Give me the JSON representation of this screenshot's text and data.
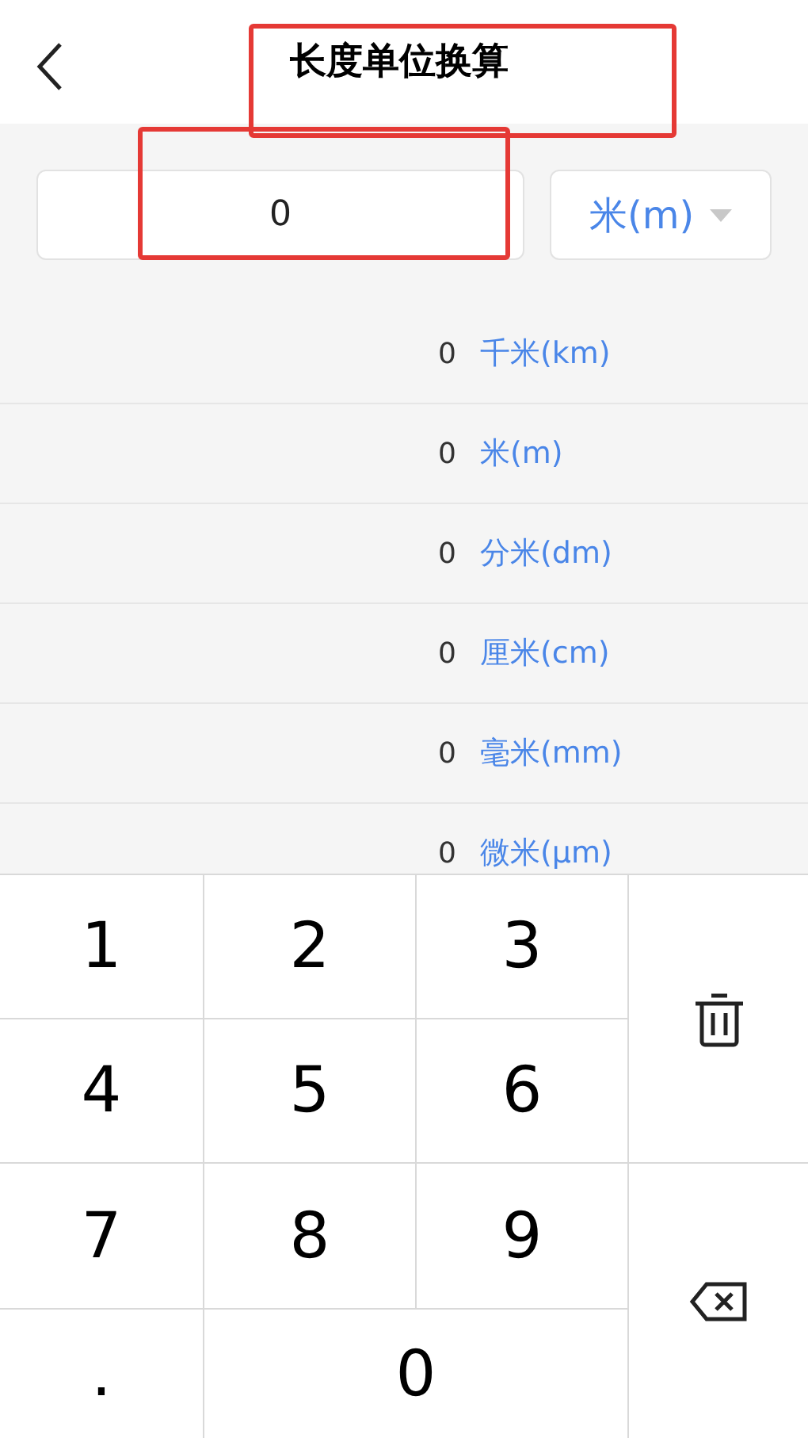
{
  "header": {
    "title": "长度单位换算"
  },
  "input": {
    "value": "0",
    "unit": "米(m)"
  },
  "results": [
    {
      "value": "0",
      "unit": "千米(km)"
    },
    {
      "value": "0",
      "unit": "米(m)"
    },
    {
      "value": "0",
      "unit": "分米(dm)"
    },
    {
      "value": "0",
      "unit": "厘米(cm)"
    },
    {
      "value": "0",
      "unit": "毫米(mm)"
    },
    {
      "value": "0",
      "unit": "微米(μm)"
    }
  ],
  "keypad": [
    {
      "kind": "digit",
      "label": "1"
    },
    {
      "kind": "digit",
      "label": "2"
    },
    {
      "kind": "digit",
      "label": "3"
    },
    {
      "kind": "clear"
    },
    {
      "kind": "digit",
      "label": "4"
    },
    {
      "kind": "digit",
      "label": "5"
    },
    {
      "kind": "digit",
      "label": "6"
    },
    {
      "kind": "digit",
      "label": "7"
    },
    {
      "kind": "digit",
      "label": "8"
    },
    {
      "kind": "digit",
      "label": "9"
    },
    {
      "kind": "backspace"
    },
    {
      "kind": "digit",
      "label": "."
    },
    {
      "kind": "wide",
      "label": "0"
    }
  ]
}
